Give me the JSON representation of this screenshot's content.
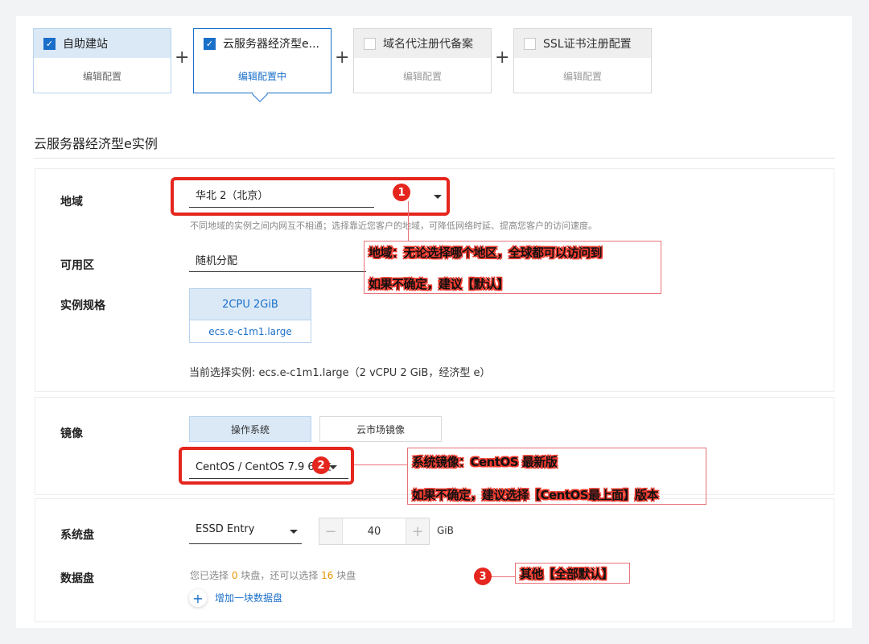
{
  "steps": [
    {
      "title": "自助建站",
      "action": "编辑配置",
      "checked": true
    },
    {
      "title": "云服务器经济型e...",
      "action": "编辑配置中",
      "checked": true
    },
    {
      "title": "域名代注册代备案",
      "action": "编辑配置",
      "checked": false
    },
    {
      "title": "SSL证书注册配置",
      "action": "编辑配置",
      "checked": false
    }
  ],
  "section_title": "云服务器经济型e实例",
  "region": {
    "label": "地域",
    "value": "华北 2（北京）",
    "hint": "不同地域的实例之间内网互不相通；选择靠近您客户的地域，可降低网络时延、提高您客户的访问速度。"
  },
  "zone": {
    "label": "可用区",
    "value": "随机分配"
  },
  "spec": {
    "label": "实例规格",
    "cpu": "2CPU 2GiB",
    "type": "ecs.e-c1m1.large",
    "current": "当前选择实例: ecs.e-c1m1.large（2 vCPU 2 GiB，经济型 e）"
  },
  "image": {
    "label": "镜像",
    "tabs": [
      "操作系统",
      "云市场镜像"
    ],
    "value": "CentOS / CentOS 7.9 64位"
  },
  "system_disk": {
    "label": "系统盘",
    "type": "ESSD Entry",
    "size": "40",
    "unit": "GiB"
  },
  "data_disk": {
    "label": "数据盘",
    "info_prefix": "您已选择",
    "selected": "0",
    "info_mid": "块盘，还可以选择",
    "remaining": "16",
    "info_suffix": "块盘",
    "add_label": "增加一块数据盘"
  },
  "annotations": {
    "n1": "1",
    "n2": "2",
    "n3": "3",
    "a1_line1": "地域：无论选择哪个地区，全球都可以访问到",
    "a1_line2": "如果不确定，建议【默认】",
    "a2_line1": "系统镜像：CentOS 最新版",
    "a2_line2": "如果不确定，建议选择【CentOS最上面】版本",
    "a3": "其他【全部默认】"
  },
  "colors": {
    "accent": "#1a6fc9",
    "annotation_red": "#e5261e",
    "warning": "#e69500"
  }
}
